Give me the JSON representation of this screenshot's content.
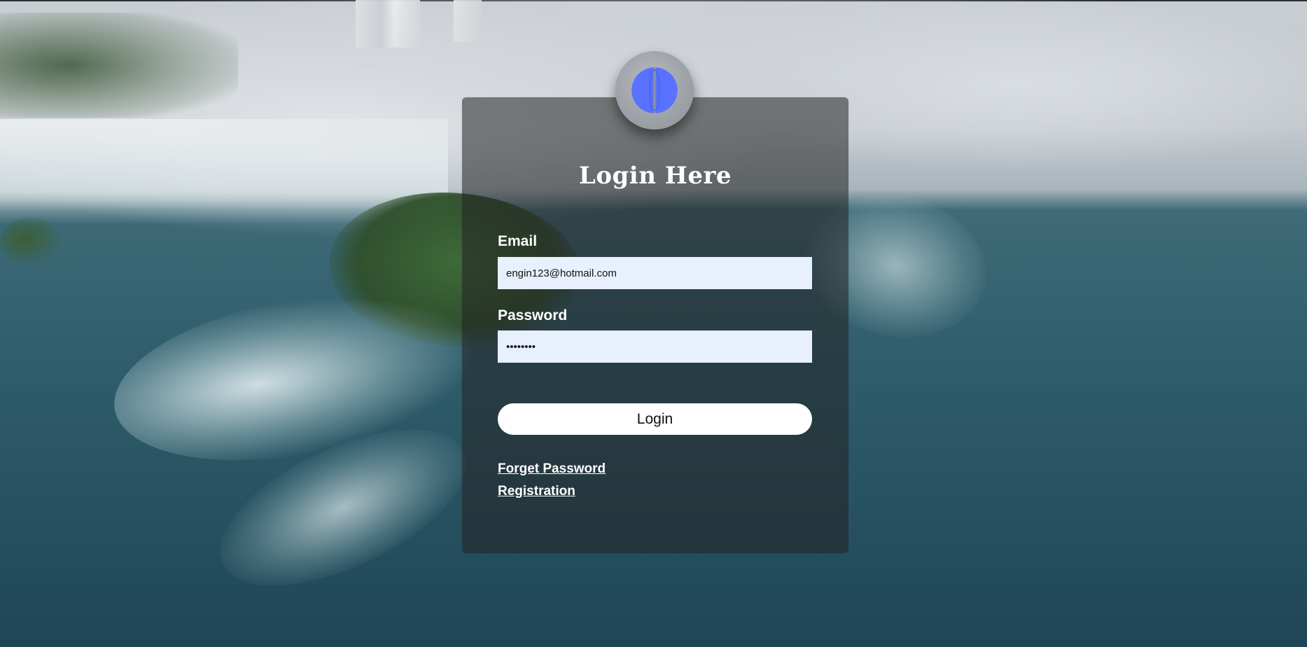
{
  "login_form": {
    "title": "Login Here",
    "email_label": "Email",
    "email_value": "engin123@hotmail.com",
    "password_label": "Password",
    "password_value": "••••••••",
    "login_button": "Login",
    "forgot_password_link": "Forget Password",
    "registration_link": "Registration"
  },
  "avatar": {
    "icon": "book-icon",
    "color": "#5b73ff"
  },
  "colors": {
    "panel_overlay": "#232323",
    "input_background": "#e8f0fe",
    "text": "#ffffff",
    "button_background": "#ffffff",
    "accent": "#5b73ff"
  }
}
